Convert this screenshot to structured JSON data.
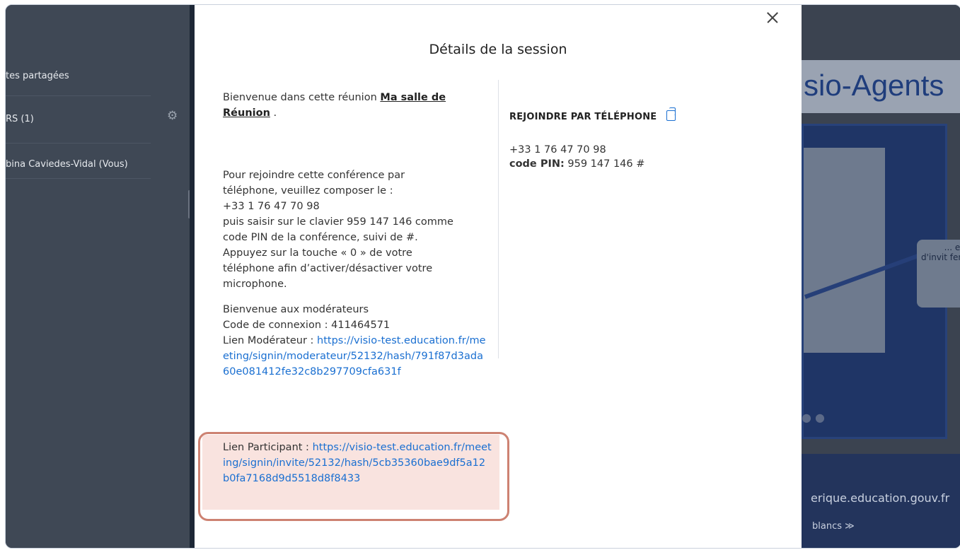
{
  "left_panel": {
    "shared_notes": "tes partagées",
    "users": "RS (1)",
    "user_name": "bina Caviedes-Vidal (Vous)"
  },
  "background": {
    "slide_title": "sio-Agents",
    "callout_text": "... et d'invit fen",
    "footer_url": "erique.education.gouv.fr",
    "footer_sub": "blancs ≫"
  },
  "modal": {
    "title": "Détails de la session",
    "welcome_prefix": "Bienvenue dans cette réunion ",
    "room_name": "Ma salle de Réunion",
    "welcome_suffix": " .",
    "phone_instructions": [
      "Pour rejoindre cette conférence par",
      "téléphone, veuillez composer le :",
      "+33 1 76 47 70 98",
      "puis saisir sur le clavier 959 147 146 comme",
      "code PIN de la conférence, suivi de #.",
      "Appuyez sur la touche « 0 » de votre",
      "téléphone afin d’activer/désactiver votre",
      "microphone."
    ],
    "moderator_welcome": "Bienvenue aux modérateurs",
    "connection_code": "Code de connexion : 411464571",
    "moderator_link_label": "Lien Modérateur  : ",
    "moderator_link_url": "https://visio-test.education.fr/meeting/signin/moderateur/52132/hash/791f87d3ada60e081412fe32c8b297709cfa631f",
    "participant_link_label": "Lien Participant  : ",
    "participant_link_url": "https://visio-test.education.fr/meeting/signin/invite/52132/hash/5cb35360bae9df5a12b0fa7168d9d5518d8f8433",
    "phone_section": {
      "heading": "REJOINDRE PAR TÉLÉPHONE",
      "number": "+33 1 76 47 70 98",
      "pin_label": "code PIN:",
      "pin_value": " 959 147 146 #"
    }
  }
}
